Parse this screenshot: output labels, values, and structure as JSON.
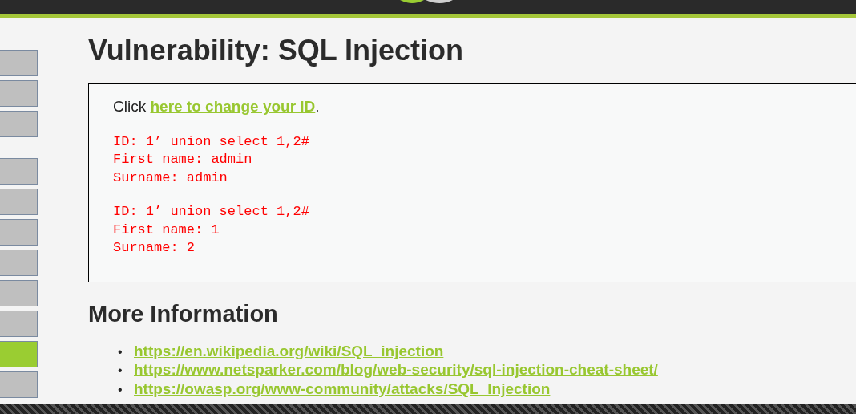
{
  "sidebar": {
    "groups": [
      {
        "items": [
          {
            "selected": false
          },
          {
            "selected": false
          },
          {
            "selected": false
          }
        ]
      },
      {
        "items": [
          {
            "selected": false
          },
          {
            "selected": false
          },
          {
            "selected": false
          },
          {
            "selected": false
          },
          {
            "selected": false
          },
          {
            "selected": false
          },
          {
            "selected": true
          },
          {
            "selected": false
          }
        ]
      }
    ]
  },
  "page": {
    "title": "Vulnerability: SQL Injection",
    "intro": {
      "prefix": "Click ",
      "link": "here to change your ID",
      "suffix": "."
    },
    "results": [
      {
        "lines": [
          "ID: 1’ union select 1,2#",
          "First name: admin",
          "Surname: admin"
        ]
      },
      {
        "lines": [
          "ID: 1’ union select 1,2#",
          "First name: 1",
          "Surname: 2"
        ]
      }
    ]
  },
  "more_info": {
    "heading": "More Information",
    "links": [
      {
        "bullet": "•",
        "url": "https://en.wikipedia.org/wiki/SQL_injection"
      },
      {
        "bullet": "•",
        "url": "https://www.netsparker.com/blog/web-security/sql-injection-cheat-sheet/"
      },
      {
        "bullet": "•",
        "url": "https://owasp.org/www-community/attacks/SQL_Injection"
      }
    ]
  }
}
